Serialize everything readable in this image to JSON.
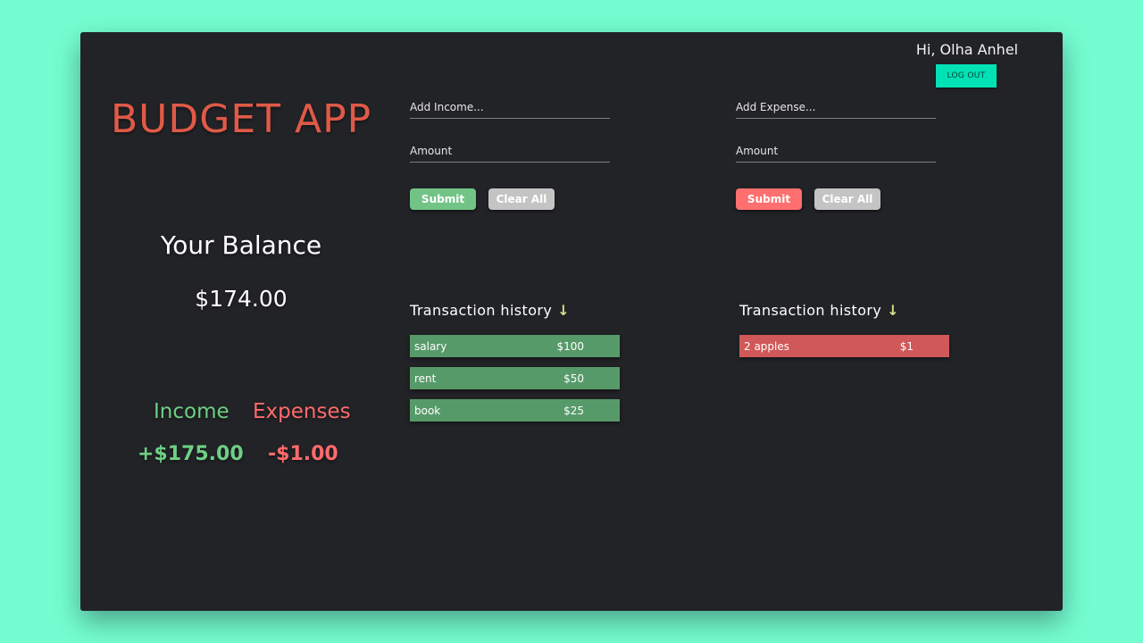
{
  "header": {
    "greeting": "Hi, Olha Anhel",
    "logout_label": "LOG OUT"
  },
  "app_title": "BUDGET APP",
  "balance": {
    "heading": "Your Balance",
    "value": "$174.00"
  },
  "summary": {
    "income_label": "Income",
    "income_value": "+$175.00",
    "expense_label": "Expenses",
    "expense_value": "-$1.00"
  },
  "income_form": {
    "name_placeholder": "Add Income...",
    "amount_placeholder": "Amount",
    "submit_label": "Submit",
    "clear_label": "Clear All"
  },
  "expense_form": {
    "name_placeholder": "Add Expense...",
    "amount_placeholder": "Amount",
    "submit_label": "Submit",
    "clear_label": "Clear All"
  },
  "income_history": {
    "title": "Transaction history",
    "arrow": "↓",
    "items": [
      {
        "name": "salary",
        "amount": "$100"
      },
      {
        "name": "rent",
        "amount": "$50"
      },
      {
        "name": "book",
        "amount": "$25"
      }
    ]
  },
  "expense_history": {
    "title": "Transaction history",
    "arrow": "↓",
    "items": [
      {
        "name": "2 apples",
        "amount": "$1"
      }
    ]
  },
  "colors": {
    "background": "#74fdd0",
    "panel": "#222327",
    "accent_title": "#e05a47",
    "income": "#6fcf85",
    "expense": "#ff6b6b",
    "logout": "#00e2b5"
  }
}
